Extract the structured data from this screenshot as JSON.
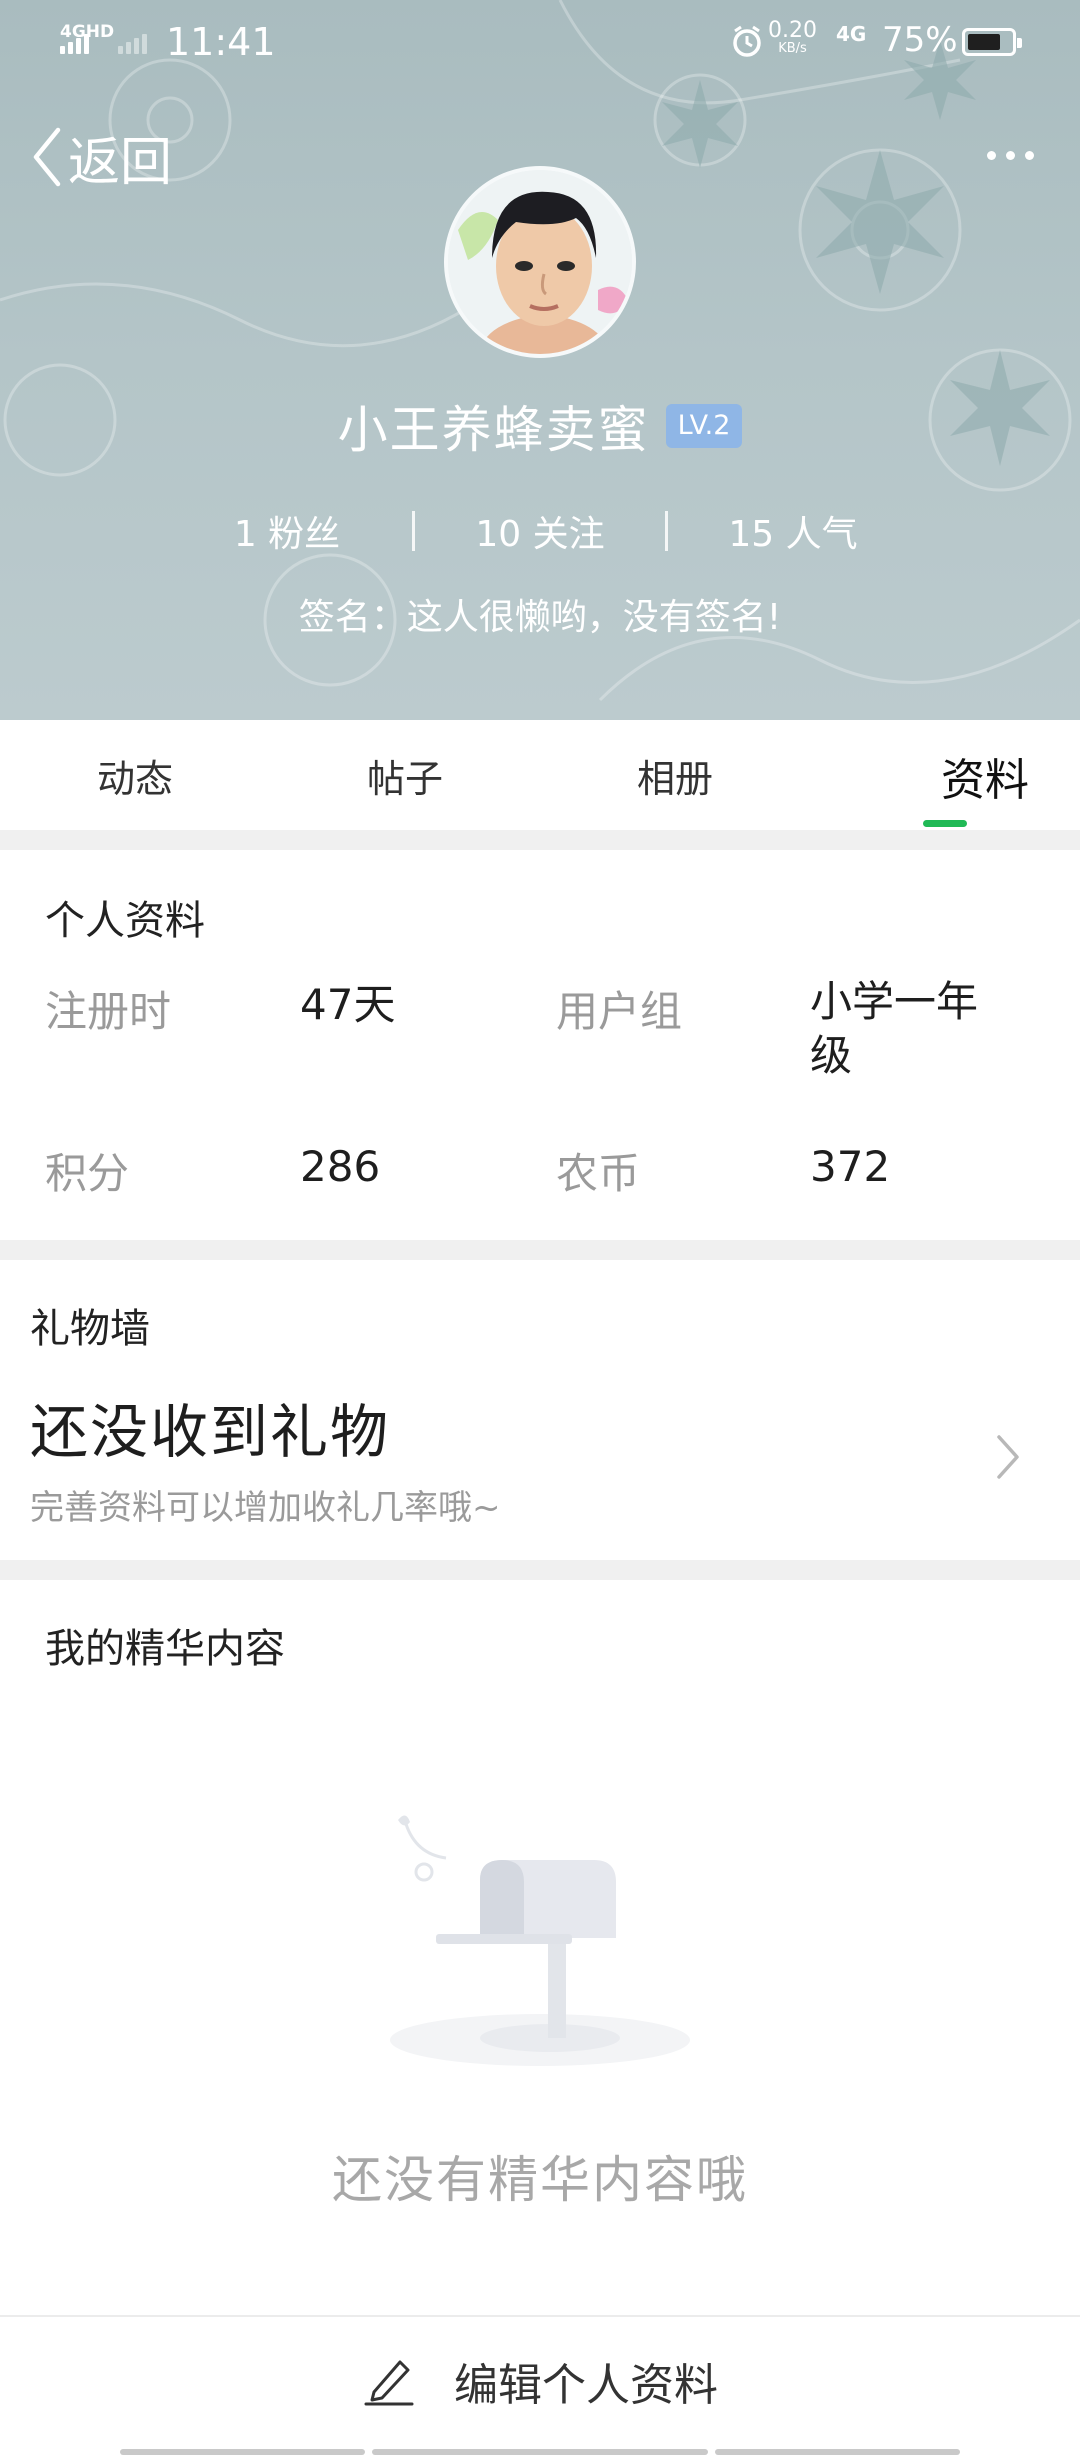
{
  "status_bar": {
    "network": "4GHD",
    "time": "11:41",
    "speed_value": "0.20",
    "speed_unit": "KB/s",
    "mobile_data": "4G",
    "battery": "75%",
    "battery_level": 0.75
  },
  "header": {
    "back_label": "返回",
    "user_name": "小王养蜂卖蜜",
    "level": "LV.2",
    "stats": {
      "fans": "1 粉丝",
      "following": "10 关注",
      "popularity": "15 人气"
    },
    "signature": "签名：这人很懒哟，没有签名!"
  },
  "tabs": [
    {
      "label": "动态"
    },
    {
      "label": "帖子"
    },
    {
      "label": "相册"
    },
    {
      "label": "资料",
      "active": true
    }
  ],
  "profile": {
    "title": "个人资料",
    "reg_label": "注册时",
    "reg_value": "47天",
    "group_label": "用户组",
    "group_value": "小学一年级",
    "points_label": "积分",
    "points_value": "286",
    "coins_label": "农币",
    "coins_value": "372"
  },
  "gift_wall": {
    "title": "礼物墙",
    "main_text": "还没收到礼物",
    "sub_text": "完善资料可以增加收礼几率哦~"
  },
  "featured": {
    "title": "我的精华内容",
    "empty_text": "还没有精华内容哦"
  },
  "bottom": {
    "edit_label": "编辑个人资料"
  },
  "colors": {
    "accent": "#20b955",
    "level_badge": "#8fb6e6",
    "muted_text": "#9a9a9a",
    "header_bg": "#b4c5c8"
  }
}
